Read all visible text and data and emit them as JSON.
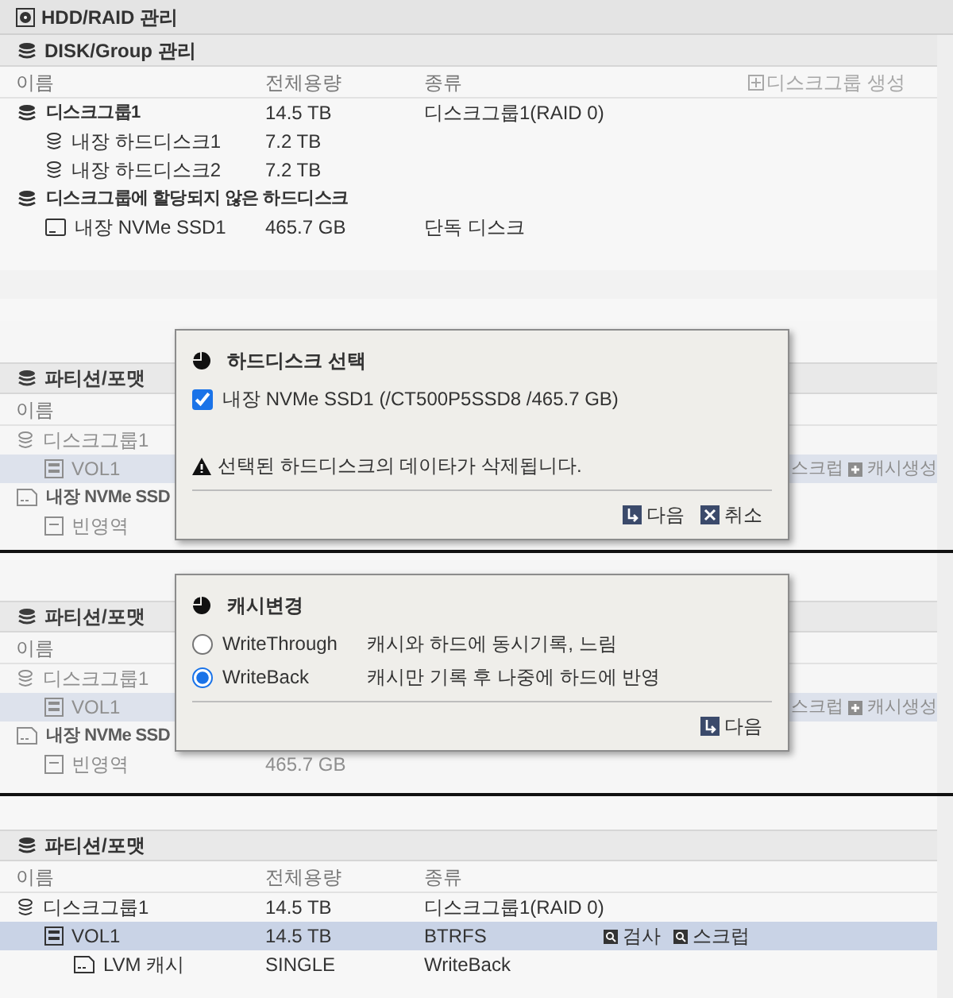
{
  "panels": [
    {
      "title": "HDD/RAID 관리",
      "disk_section": {
        "title": "DISK/Group 관리",
        "columns": [
          "이름",
          "전체용량",
          "종류"
        ],
        "action": {
          "label": "디스크그룹 생성",
          "disabled": true
        },
        "rows": [
          {
            "kind": "group",
            "name": "디스크그룹1",
            "capacity": "14.5 TB",
            "type": "디스크그룹1(RAID 0)",
            "selected": false,
            "children": [
              {
                "kind": "member",
                "name": "내장 하드디스크1",
                "capacity": "7.2 TB",
                "selected": false
              },
              {
                "kind": "member",
                "name": "내장 하드디스크2",
                "capacity": "7.2 TB",
                "selected": false
              }
            ]
          },
          {
            "kind": "group",
            "name": "디스크그룹에 할당되지 않은 하드디스크",
            "selected": false,
            "children": [
              {
                "kind": "ssd",
                "name": "내장 NVMe SSD1",
                "capacity": "465.7 GB",
                "type": "단독 디스크",
                "selected": false
              }
            ]
          }
        ]
      },
      "partition": {
        "title": "파티션/포맷",
        "dimmed": true,
        "columns": [
          "이름"
        ],
        "rows": [
          {
            "kind": "pool",
            "name": "디스크그룹1",
            "selected": false,
            "children": [
              {
                "kind": "volume",
                "name": "VOL1",
                "selected": true,
                "actions": [
                  {
                    "kind": "plain",
                    "label": "스크럽"
                  },
                  {
                    "kind": "plus",
                    "label": "캐시생성"
                  }
                ]
              }
            ]
          },
          {
            "kind": "ssd_header",
            "name": "내장 NVMe SSD",
            "selected": false,
            "children": [
              {
                "kind": "free",
                "name": "빈영역",
                "selected": false
              }
            ]
          }
        ]
      },
      "dialog": {
        "title": "하드디스크 선택",
        "options": [
          {
            "kind": "checkbox",
            "label": "내장 NVMe SSD1 (/CT500P5SSD8 /465.7 GB)",
            "checked": true
          }
        ],
        "warning": "선택된 하드디스크의 데이타가 삭제됩니다.",
        "buttons": [
          {
            "kind": "next",
            "label": "다음"
          },
          {
            "kind": "cancel",
            "label": "취소"
          }
        ]
      }
    },
    {
      "partition": {
        "title": "파티션/포맷",
        "dimmed": true,
        "columns": [
          "이름"
        ],
        "rows": [
          {
            "kind": "pool",
            "name": "디스크그룹1",
            "selected": false,
            "children": [
              {
                "kind": "volume",
                "name": "VOL1",
                "selected": true,
                "actions": [
                  {
                    "kind": "plain",
                    "label": "스크럽"
                  },
                  {
                    "kind": "plus",
                    "label": "캐시생성"
                  }
                ]
              }
            ]
          },
          {
            "kind": "ssd_header",
            "name": "내장 NVMe SSD",
            "selected": false,
            "children": [
              {
                "kind": "free",
                "name": "빈영역",
                "capacity": "465.7 GB",
                "selected": false
              }
            ]
          }
        ]
      },
      "dialog": {
        "title": "캐시변경",
        "options": [
          {
            "kind": "radio",
            "label": "WriteThrough",
            "detail": "캐시와 하드에 동시기록, 느림",
            "selected": false
          },
          {
            "kind": "radio",
            "label": "WriteBack",
            "detail": "캐시만 기록 후 나중에 하드에 반영",
            "selected": true
          }
        ],
        "buttons": [
          {
            "kind": "next",
            "label": "다음"
          }
        ]
      }
    },
    {
      "partition": {
        "title": "파티션/포맷",
        "dimmed": false,
        "columns": [
          "이름",
          "전체용량",
          "종류"
        ],
        "rows": [
          {
            "kind": "pool",
            "name": "디스크그룹1",
            "capacity": "14.5 TB",
            "type": "디스크그룹1(RAID 0)",
            "selected": false,
            "children": [
              {
                "kind": "volume",
                "name": "VOL1",
                "capacity": "14.5 TB",
                "type": "BTRFS",
                "selected": true,
                "actions": [
                  {
                    "kind": "scan",
                    "label": "검사"
                  },
                  {
                    "kind": "scan",
                    "label": "스크럽"
                  }
                ],
                "children": [
                  {
                    "kind": "cache",
                    "name": "LVM 캐시",
                    "capacity": "SINGLE",
                    "type": "WriteBack",
                    "selected": false
                  }
                ]
              }
            ]
          }
        ]
      }
    }
  ]
}
